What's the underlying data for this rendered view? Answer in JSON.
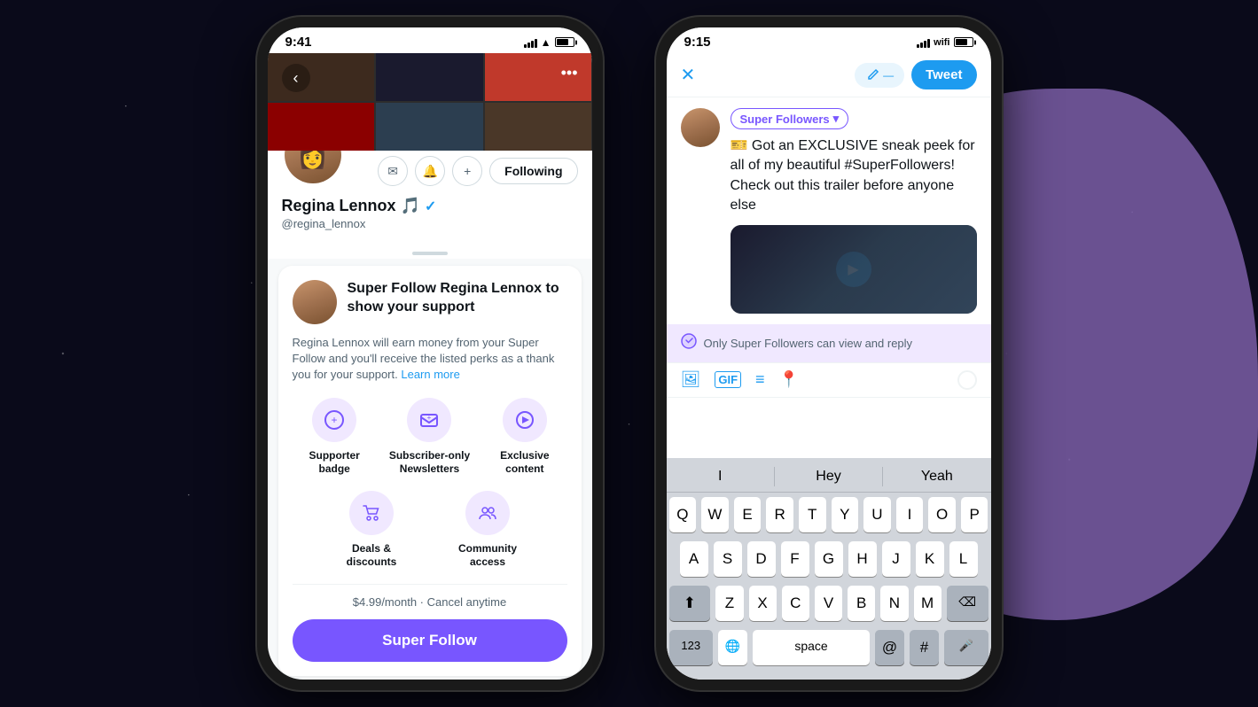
{
  "background": {
    "color": "#0a0a1a"
  },
  "phone1": {
    "status_bar": {
      "time": "9:41"
    },
    "profile": {
      "name": "Regina Lennox 🎵",
      "handle": "@regina_lennox",
      "verified": true,
      "following_label": "Following"
    },
    "super_follow_card": {
      "title": "Super Follow Regina Lennox to show your support",
      "description": "Regina Lennox will earn money from your Super Follow and you'll receive the listed perks as a thank you for your support.",
      "learn_more": "Learn more",
      "perks": [
        {
          "icon": "➕",
          "label": "Supporter badge"
        },
        {
          "icon": "📰",
          "label": "Subscriber-only Newsletters"
        },
        {
          "icon": "▶",
          "label": "Exclusive content"
        },
        {
          "icon": "🛒",
          "label": "Deals & discounts"
        },
        {
          "icon": "👥",
          "label": "Community access"
        }
      ],
      "pricing": "$4.99/month · Cancel anytime",
      "button_label": "Super Follow"
    }
  },
  "phone2": {
    "status_bar": {
      "time": "9:15"
    },
    "composer": {
      "close_icon": "✕",
      "draft_label": "draft",
      "tweet_button": "Tweet",
      "audience": "Super Followers",
      "tweet_text": "🎫 Got an EXCLUSIVE sneak peek for all of my beautiful #SuperFollowers! Check out this trailer before anyone else",
      "notice_text": "Only Super Followers can view and reply"
    },
    "keyboard": {
      "predictive": [
        "I",
        "Hey",
        "Yeah"
      ],
      "rows": [
        [
          "Q",
          "W",
          "E",
          "R",
          "T",
          "Y",
          "U",
          "I",
          "O",
          "P"
        ],
        [
          "A",
          "S",
          "D",
          "F",
          "G",
          "H",
          "J",
          "K",
          "L"
        ],
        [
          "⬆",
          "Z",
          "X",
          "C",
          "V",
          "B",
          "N",
          "M",
          "⌫"
        ],
        [
          "123",
          "space",
          "@",
          "#"
        ]
      ]
    }
  }
}
